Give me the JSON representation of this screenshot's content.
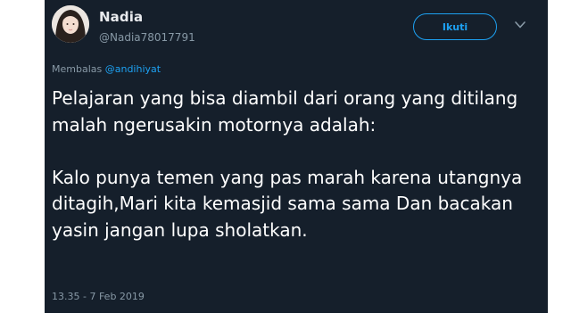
{
  "user": {
    "display_name": "Nadia",
    "handle": "@Nadia78017791",
    "avatar_icon": "profile-photo-avatar"
  },
  "follow_button": {
    "label": "Ikuti"
  },
  "menu_icon": "chevron-down-icon",
  "reply": {
    "prefix": "Membalas",
    "to_handle": "@andihiyat"
  },
  "tweet": {
    "text": "Pelajaran yang bisa diambil dari orang yang ditilang malah ngerusakin motornya adalah:\n\nKalo punya temen yang pas marah karena utangnya ditagih,Mari kita kemasjid sama sama Dan bacakan yasin jangan lupa sholatkan.",
    "timestamp": "13.35 - 7 Feb 2019"
  },
  "colors": {
    "card_background": "#151f2b",
    "accent": "#1da1f2",
    "muted_text": "#8899a6",
    "primary_text": "#ffffff"
  }
}
